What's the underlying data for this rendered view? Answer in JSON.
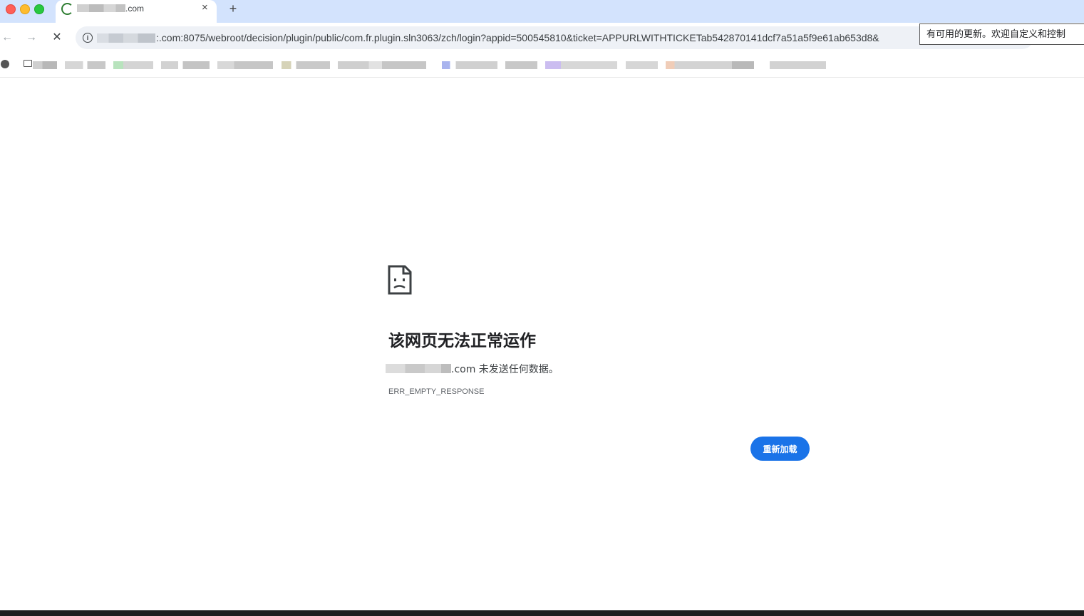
{
  "tab": {
    "title_visible": ".com",
    "close_glyph": "×",
    "new_tab_glyph": "+"
  },
  "toolbar": {
    "back_glyph": "←",
    "forward_glyph": "→",
    "stop_glyph": "✕",
    "url_visible": ":.com:8075/webroot/decision/plugin/public/com.fr.plugin.sln3063/zch/login?appid=500545810&ticket=APPURLWITHTICKETab542870141dcf7a51a5f9e61ab653d8&"
  },
  "tooltip": {
    "text": "有可用的更新。欢迎自定义和控制"
  },
  "error": {
    "heading": "该网页无法正常运作",
    "description": ".com 未发送任何数据。",
    "code": "ERR_EMPTY_RESPONSE",
    "reload_label": "重新加载"
  },
  "colors": {
    "tab_strip": "#d3e3fd",
    "accent": "#1a73e8",
    "spinner": "#2e7d32"
  },
  "icons": [
    "loading-spinner-icon",
    "info-icon",
    "globe-icon",
    "folder-icon",
    "sad-page-icon"
  ]
}
